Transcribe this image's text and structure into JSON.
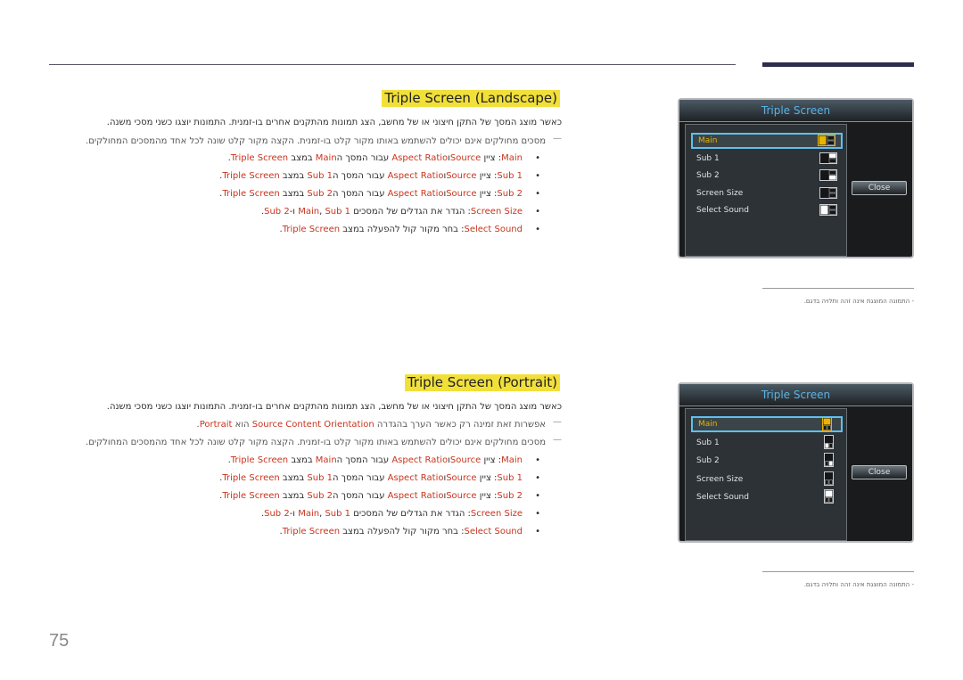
{
  "page": {
    "number": "75"
  },
  "colors": {
    "highlight": "#c8341d",
    "title_bg": "#f2e03a",
    "osd_title": "#5ab3e6",
    "osd_selected": "#e8b400",
    "header_bar": "#2c2e4a"
  },
  "landscape": {
    "title": "Triple Screen (Landscape)",
    "intro": "כאשר מוצג המסך של התקן חיצוני או של מחשב, הצג תמונות מהתקנים אחרים בו-זמנית. התמונות יוצגו כשני מסכי משנה.",
    "notes": [
      "מסכים מחולקים אינם יכולים להשתמש באותו מקור קלט בו-זמנית. הקצה מקור קלט שונה לכל אחד מהמסכים המחולקים."
    ],
    "bullets": [
      {
        "term": "Main",
        "sep": ": ציין ",
        "a": "Source",
        "and": "ו",
        "b": "Aspect Ratio",
        "mid": " עבור המסך ה",
        "c": "Main",
        "end": " במצב ",
        "d": "Triple Screen",
        "dot": "."
      },
      {
        "term": "Sub 1",
        "sep": ": ציין ",
        "a": "Source",
        "and": "ו",
        "b": "Aspect Ratio",
        "mid": " עבור המסך ה",
        "c": "Sub 1",
        "end": " במצב ",
        "d": "Triple Screen",
        "dot": "."
      },
      {
        "term": "Sub 2",
        "sep": ": ציין ",
        "a": "Source",
        "and": "ו",
        "b": "Aspect Ratio",
        "mid": " עבור המסך ה",
        "c": "Sub 2",
        "end": " במצב ",
        "d": "Triple Screen",
        "dot": "."
      },
      {
        "term": "Screen Size",
        "sep": ": הגדר את הגדלים של המסכים ",
        "a": "Main",
        "and": ", ",
        "b": "Sub 1",
        "mid": " ו-",
        "c": "Sub 2",
        "end": "",
        "d": "",
        "dot": "."
      },
      {
        "term": "Select Sound",
        "sep": ": בחר מקור קול להפעלה במצב ",
        "a": "Triple Screen",
        "and": "",
        "b": "",
        "mid": "",
        "c": "",
        "end": "",
        "d": "",
        "dot": "."
      }
    ],
    "osd": {
      "title": "Triple Screen",
      "items": [
        {
          "label": "Main",
          "icon": "layout-main-selected-icon",
          "selected": true
        },
        {
          "label": "Sub 1",
          "icon": "layout-sub1-icon",
          "selected": false
        },
        {
          "label": "Sub 2",
          "icon": "layout-sub2-icon",
          "selected": false
        },
        {
          "label": "Screen Size",
          "icon": "layout-screen-size-icon",
          "selected": false
        },
        {
          "label": "Select Sound",
          "icon": "layout-select-sound-icon",
          "selected": false
        }
      ],
      "close_label": "Close"
    },
    "footnote": "- התמונה המוצגת אינה זהה ותלויה בדגם."
  },
  "portrait": {
    "title": "Triple Screen (Portrait)",
    "intro": "כאשר מוצג המסך של התקן חיצוני או של מחשב, הצג תמונות מהתקנים אחרים בו-זמנית. התמונות יוצגו כשני מסכי משנה.",
    "note_orientation": {
      "pre": "אפשרות זאת זמינה רק כאשר הערך בהגדרה ",
      "term": "Source Content Orientation",
      "mid": " הוא ",
      "value": "Portrait",
      "dot": "."
    },
    "notes": [
      "מסכים מחולקים אינם יכולים להשתמש באותו מקור קלט בו-זמנית. הקצה מקור קלט שונה לכל אחד מהמסכים המחולקים."
    ],
    "bullets": [
      {
        "term": "Main",
        "sep": ": ציין ",
        "a": "Source",
        "and": "ו",
        "b": "Aspect Ratio",
        "mid": " עבור המסך ה",
        "c": "Main",
        "end": " במצב ",
        "d": "Triple Screen",
        "dot": "."
      },
      {
        "term": "Sub 1",
        "sep": ": ציין ",
        "a": "Source",
        "and": "ו",
        "b": "Aspect Ratio",
        "mid": " עבור המסך ה",
        "c": "Sub 1",
        "end": " במצב ",
        "d": "Triple Screen",
        "dot": "."
      },
      {
        "term": "Sub 2",
        "sep": ": ציין ",
        "a": "Source",
        "and": "ו",
        "b": "Aspect Ratio",
        "mid": " עבור המסך ה",
        "c": "Sub 2",
        "end": " במצב ",
        "d": "Triple Screen",
        "dot": "."
      },
      {
        "term": "Screen Size",
        "sep": ": הגדר את הגדלים של המסכים ",
        "a": "Main",
        "and": ", ",
        "b": "Sub 1",
        "mid": " ו-",
        "c": "Sub 2",
        "end": "",
        "d": "",
        "dot": "."
      },
      {
        "term": "Select Sound",
        "sep": ": בחר מקור קול להפעלה במצב ",
        "a": "Triple Screen",
        "and": "",
        "b": "",
        "mid": "",
        "c": "",
        "end": "",
        "d": "",
        "dot": "."
      }
    ],
    "osd": {
      "title": "Triple Screen",
      "items": [
        {
          "label": "Main",
          "icon": "portrait-main-selected-icon",
          "selected": true
        },
        {
          "label": "Sub 1",
          "icon": "portrait-sub1-icon",
          "selected": false
        },
        {
          "label": "Sub 2",
          "icon": "portrait-sub2-icon",
          "selected": false
        },
        {
          "label": "Screen Size",
          "icon": "portrait-screen-size-icon",
          "selected": false
        },
        {
          "label": "Select Sound",
          "icon": "portrait-select-sound-icon",
          "selected": false
        }
      ],
      "close_label": "Close"
    },
    "footnote": "- התמונה המוצגת אינה זהה ותלויה בדגם."
  }
}
